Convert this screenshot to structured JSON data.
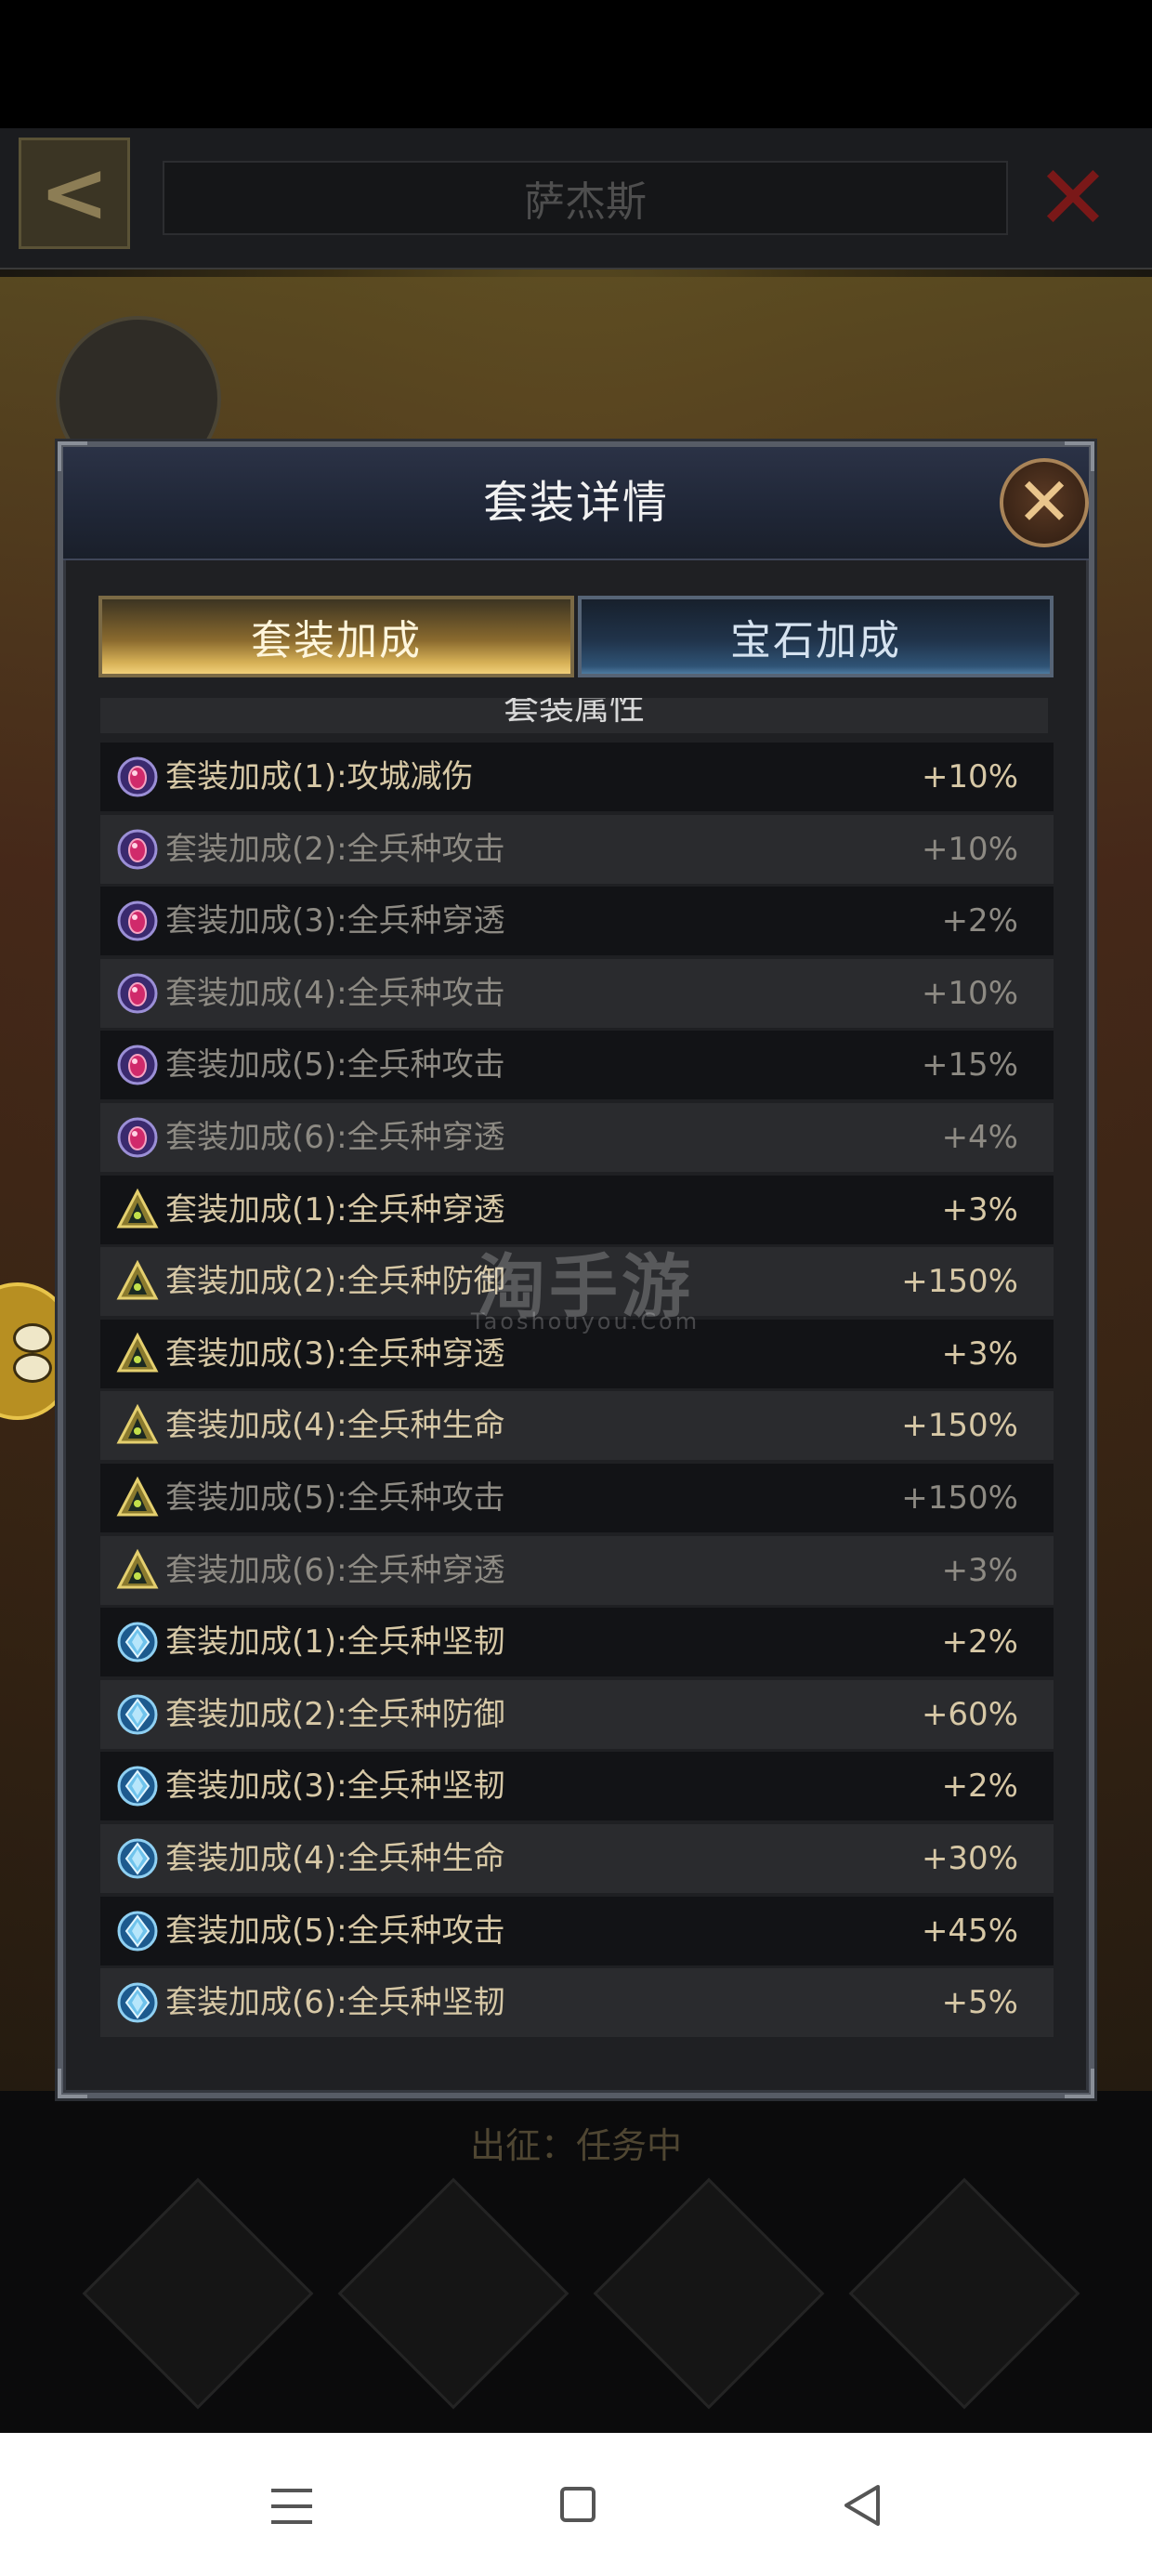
{
  "background": {
    "header_title": "萨杰斯",
    "footer_status": "出征：任务中"
  },
  "dialog": {
    "title": "套装详情",
    "tabs": [
      {
        "label": "套装加成",
        "active": true
      },
      {
        "label": "宝石加成",
        "active": false
      }
    ],
    "section_label": "套装属性",
    "rows": [
      {
        "icon": "purple-gem-icon",
        "label": "套装加成(1):攻城减伤",
        "value": "+10%",
        "dim": false
      },
      {
        "icon": "purple-gem-icon",
        "label": "套装加成(2):全兵种攻击",
        "value": "+10%",
        "dim": true
      },
      {
        "icon": "purple-gem-icon",
        "label": "套装加成(3):全兵种穿透",
        "value": "+2%",
        "dim": true
      },
      {
        "icon": "purple-gem-icon",
        "label": "套装加成(4):全兵种攻击",
        "value": "+10%",
        "dim": true
      },
      {
        "icon": "purple-gem-icon",
        "label": "套装加成(5):全兵种攻击",
        "value": "+15%",
        "dim": true
      },
      {
        "icon": "purple-gem-icon",
        "label": "套装加成(6):全兵种穿透",
        "value": "+4%",
        "dim": true
      },
      {
        "icon": "gold-pyramid-icon",
        "label": "套装加成(1):全兵种穿透",
        "value": "+3%",
        "dim": false
      },
      {
        "icon": "gold-pyramid-icon",
        "label": "套装加成(2):全兵种防御",
        "value": "+150%",
        "dim": false
      },
      {
        "icon": "gold-pyramid-icon",
        "label": "套装加成(3):全兵种穿透",
        "value": "+3%",
        "dim": false
      },
      {
        "icon": "gold-pyramid-icon",
        "label": "套装加成(4):全兵种生命",
        "value": "+150%",
        "dim": false
      },
      {
        "icon": "gold-pyramid-icon",
        "label": "套装加成(5):全兵种攻击",
        "value": "+150%",
        "dim": true
      },
      {
        "icon": "gold-pyramid-icon",
        "label": "套装加成(6):全兵种穿透",
        "value": "+3%",
        "dim": true
      },
      {
        "icon": "blue-crystal-icon",
        "label": "套装加成(1):全兵种坚韧",
        "value": "+2%",
        "dim": false
      },
      {
        "icon": "blue-crystal-icon",
        "label": "套装加成(2):全兵种防御",
        "value": "+60%",
        "dim": false
      },
      {
        "icon": "blue-crystal-icon",
        "label": "套装加成(3):全兵种坚韧",
        "value": "+2%",
        "dim": false
      },
      {
        "icon": "blue-crystal-icon",
        "label": "套装加成(4):全兵种生命",
        "value": "+30%",
        "dim": false
      },
      {
        "icon": "blue-crystal-icon",
        "label": "套装加成(5):全兵种攻击",
        "value": "+45%",
        "dim": false
      },
      {
        "icon": "blue-crystal-icon",
        "label": "套装加成(6):全兵种坚韧",
        "value": "+5%",
        "dim": false
      }
    ]
  },
  "watermark": {
    "main": "淘手游",
    "sub": "Taoshouyou.Com"
  },
  "colors": {
    "text_active": "#d7c8a6",
    "text_dim": "#8d8a83",
    "tab_gold": "#d6b056",
    "tab_blue": "#2f5375"
  }
}
